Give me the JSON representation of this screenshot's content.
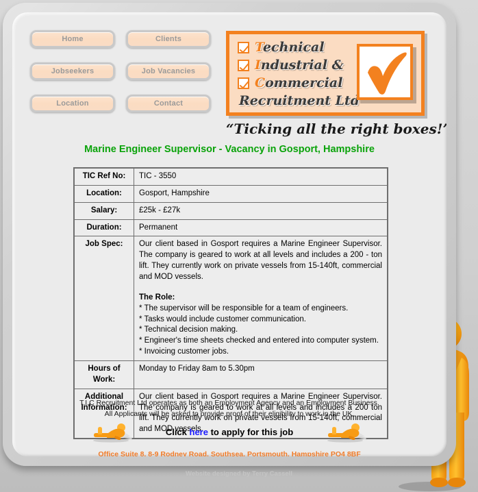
{
  "nav": {
    "left": [
      {
        "label": "Home",
        "name": "nav-home"
      },
      {
        "label": "Jobseekers",
        "name": "nav-jobseekers"
      },
      {
        "label": "Location",
        "name": "nav-location"
      }
    ],
    "right": [
      {
        "label": "Clients",
        "name": "nav-clients"
      },
      {
        "label": "Job Vacancies",
        "name": "nav-job-vacancies"
      },
      {
        "label": "Contact",
        "name": "nav-contact"
      }
    ]
  },
  "logo": {
    "line1_cap": "T",
    "line1_rest": "echnical",
    "line2_cap": "I",
    "line2_rest": "ndustrial &",
    "line3_cap": "C",
    "line3_rest": "ommercial",
    "line4": "Recruitment Ltd",
    "tagline": "“Ticking all the right boxes!”",
    "tick_icon": "check-mark-icon",
    "accent": "#f3811f",
    "panel_bg": "#fbdcc2"
  },
  "page_title": "Marine Engineer Supervisor - Vacancy in Gosport, Hampshire",
  "title_color": "#0aa30a",
  "vacancy": {
    "rows": [
      {
        "label": "TIC Ref No:",
        "value": "TIC - 3550",
        "name": "row-tic-ref-no"
      },
      {
        "label": "Location:",
        "value": "Gosport, Hampshire",
        "name": "row-location"
      },
      {
        "label": "Salary:",
        "value": "£25k - £27k",
        "name": "row-salary"
      },
      {
        "label": "Duration:",
        "value": "Permanent",
        "name": "row-duration"
      }
    ],
    "job_spec": {
      "label": "Job Spec:",
      "paragraph": "Our client based in Gosport requires a Marine Engineer Supervisor. The company is geared to work at all levels and includes a 200 - ton lift. They currently work on private vessels from 15-140ft, commercial and MOD vessels.",
      "role_heading": "The Role:",
      "bullets": [
        "* The supervisor will be responsible for a team of engineers.",
        "* Tasks would include customer communication.",
        "* Technical decision making.",
        "* Engineer's time sheets checked and entered into computer system.",
        "* Invoicing customer jobs."
      ]
    },
    "hours": {
      "label": "Hours of Work:",
      "value": "Monday to Friday 8am to 5.30pm"
    },
    "additional": {
      "label": "Additional Information:",
      "value": "Our client based in Gosport requires a Marine Engineer Supervisor. The company is geared to work at all levels and includes a 200 ton lift. They currently work on private vessels from 15-140ft, commercial and MOD vessels."
    }
  },
  "blurb": {
    "line1": "T.I.C Recruitment Ltd operates as both an Employment Agency and an Employment Business.",
    "line2": "All Applicants will be asked to provide proof of their eligibility to work in the UK."
  },
  "apply": {
    "prefix": "Click ",
    "link": "here",
    "suffix": " to apply for this job",
    "link_color": "#1a1aff",
    "icon_left": "person-at-laptop-icon",
    "icon_right": "person-at-laptop-icon"
  },
  "address": "Office Suite 8, 8-9 Rodney Road, Southsea, Portsmouth, Hampshire PO4 8BF",
  "address_color": "#f07c2a",
  "mascot": {
    "name": "standing-person-pointing-icon",
    "color": "#fbae17"
  },
  "footer": "Website designed by Terry Cassell"
}
